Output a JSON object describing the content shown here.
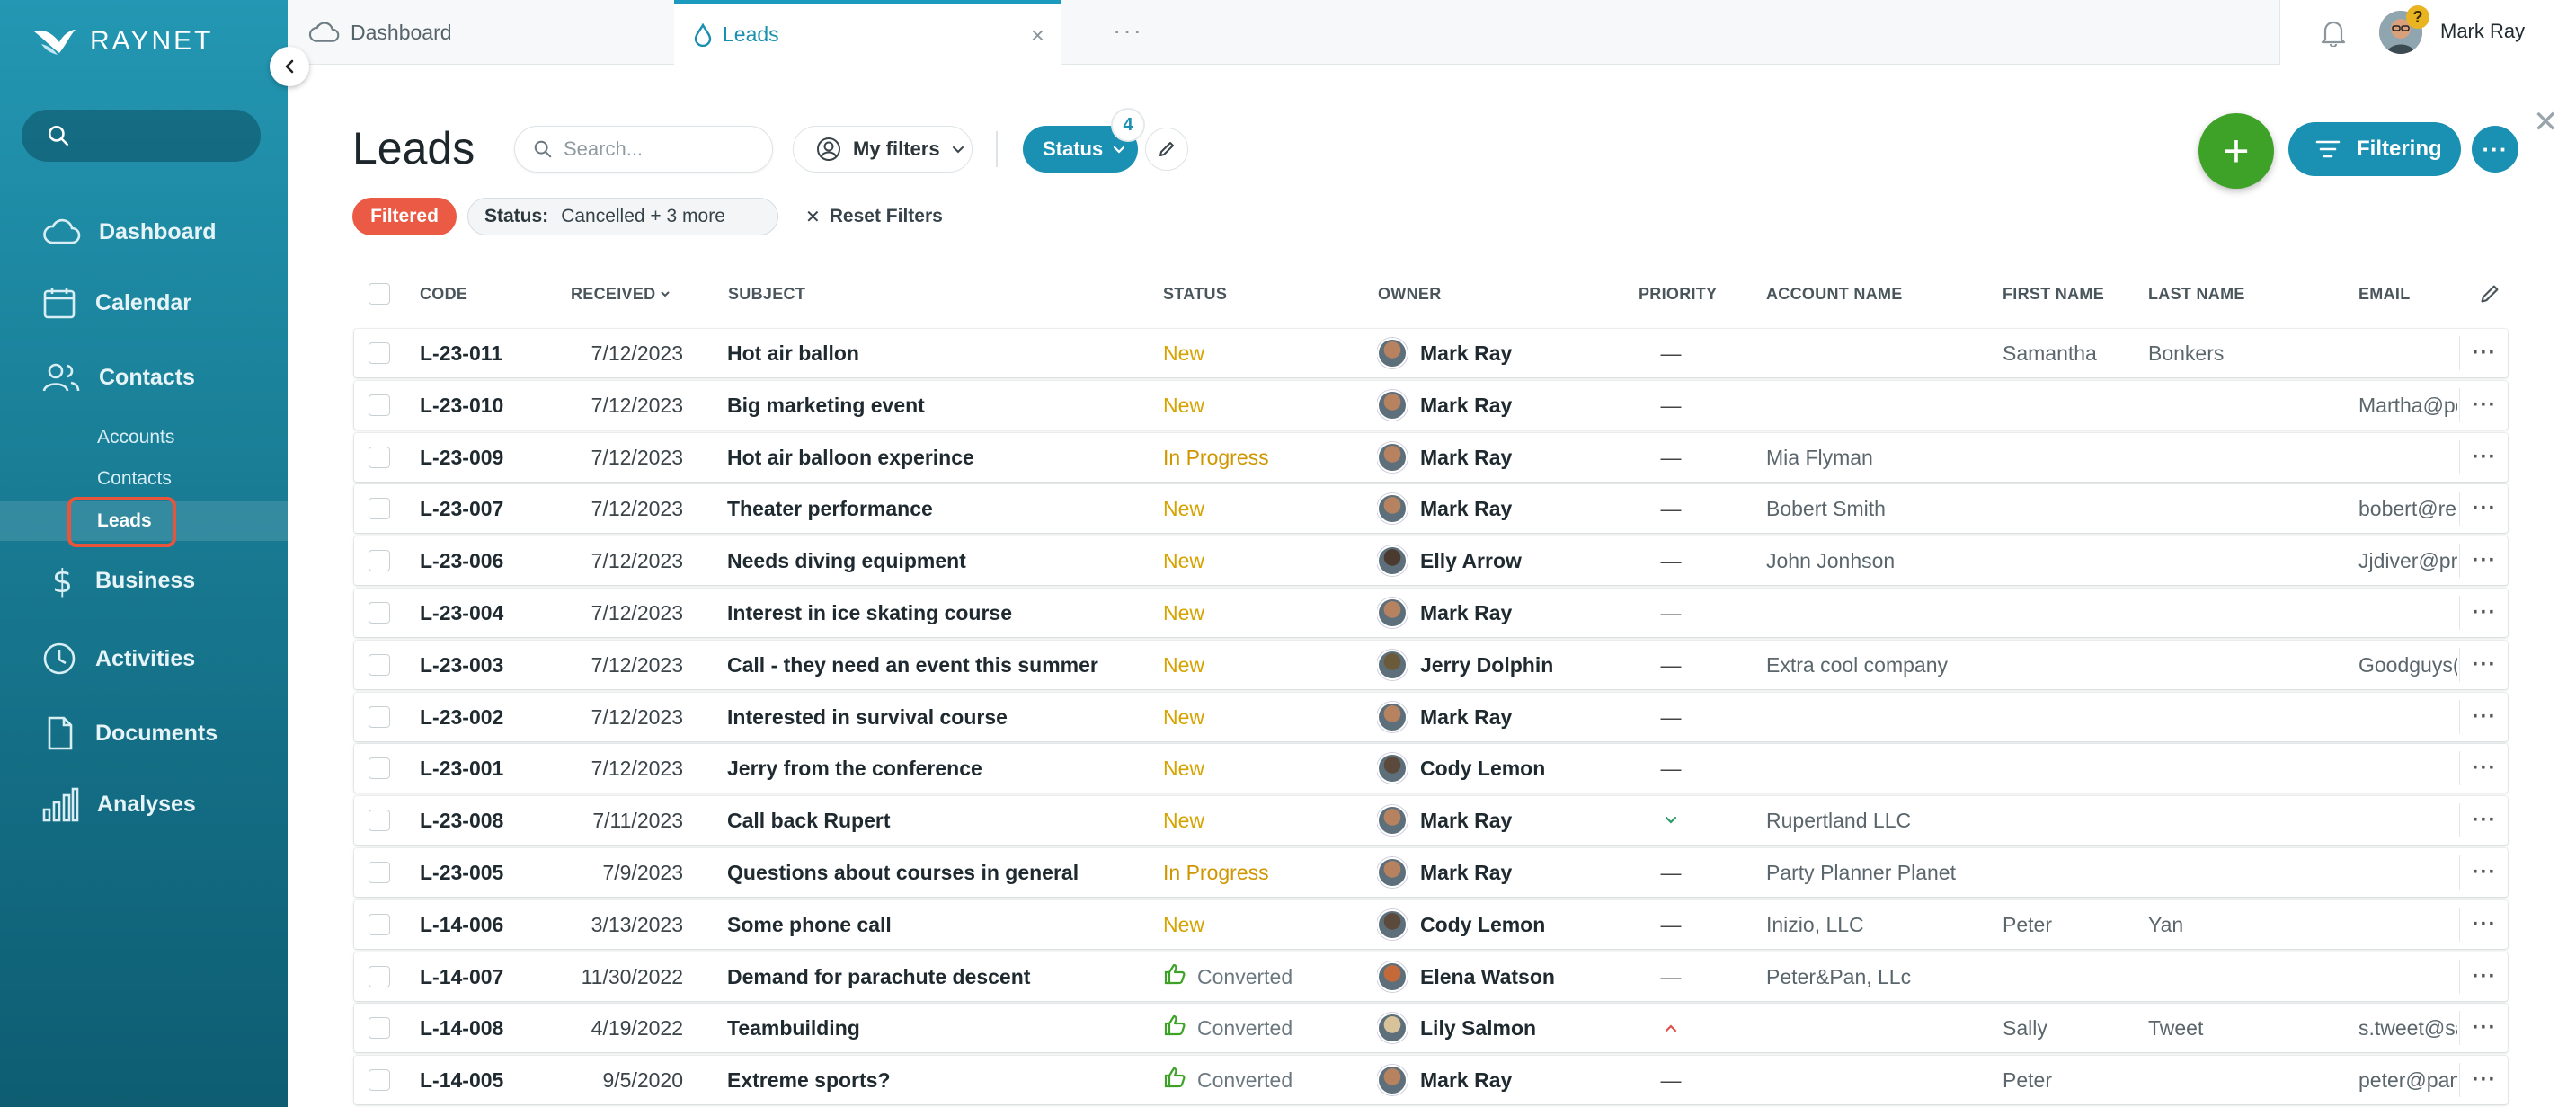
{
  "app": {
    "brand": "RAYNET"
  },
  "sidebar": {
    "search_placeholder": "",
    "nav": [
      {
        "label": "Dashboard",
        "icon": "cloud-icon"
      },
      {
        "label": "Calendar",
        "icon": "calendar-icon"
      },
      {
        "label": "Contacts",
        "icon": "contacts-icon"
      },
      {
        "label": "Business",
        "icon": "dollar-icon"
      },
      {
        "label": "Activities",
        "icon": "clock-icon"
      },
      {
        "label": "Documents",
        "icon": "document-icon"
      },
      {
        "label": "Analyses",
        "icon": "bar-chart-icon"
      }
    ],
    "sub_items": [
      {
        "label": "Accounts"
      },
      {
        "label": "Contacts"
      },
      {
        "label": "Leads",
        "active": true
      }
    ]
  },
  "tabs": [
    {
      "label": "Dashboard",
      "icon": "cloud-icon"
    },
    {
      "label": "Leads",
      "icon": "lead-drop-icon",
      "active": true
    }
  ],
  "user": {
    "name": "Mark Ray",
    "help_badge": "?"
  },
  "header": {
    "title": "Leads",
    "search_placeholder": "Search...",
    "my_filters": "My filters",
    "status_label": "Status",
    "status_count": "4",
    "add_symbol": "+",
    "filtering_label": "Filtering"
  },
  "filters": {
    "filtered_label": "Filtered",
    "status_key": "Status:",
    "status_value": "Cancelled + 3 more",
    "reset_label": "Reset Filters"
  },
  "table": {
    "columns": [
      "CODE",
      "RECEIVED",
      "SUBJECT",
      "STATUS",
      "OWNER",
      "PRIORITY",
      "ACCOUNT NAME",
      "FIRST NAME",
      "LAST NAME",
      "EMAIL"
    ],
    "rows": [
      {
        "code": "L-23-011",
        "received": "7/12/2023",
        "subject": "Hot air ballon",
        "status": "New",
        "owner": "Mark Ray",
        "priority": "—",
        "account": "",
        "first": "Samantha",
        "last": "Bonkers",
        "email": ""
      },
      {
        "code": "L-23-010",
        "received": "7/12/2023",
        "subject": "Big marketing event",
        "status": "New",
        "owner": "Mark Ray",
        "priority": "—",
        "account": "",
        "first": "",
        "last": "",
        "email": "Martha@pe"
      },
      {
        "code": "L-23-009",
        "received": "7/12/2023",
        "subject": "Hot air balloon experince",
        "status": "In Progress",
        "owner": "Mark Ray",
        "priority": "—",
        "account": "Mia Flyman",
        "first": "",
        "last": "",
        "email": ""
      },
      {
        "code": "L-23-007",
        "received": "7/12/2023",
        "subject": "Theater performance",
        "status": "New",
        "owner": "Mark Ray",
        "priority": "—",
        "account": "Bobert Smith",
        "first": "",
        "last": "",
        "email": "bobert@re"
      },
      {
        "code": "L-23-006",
        "received": "7/12/2023",
        "subject": "Needs diving equipment",
        "status": "New",
        "owner": "Elly Arrow",
        "priority": "—",
        "account": "John Jonhson",
        "first": "",
        "last": "",
        "email": "Jjdiver@pr"
      },
      {
        "code": "L-23-004",
        "received": "7/12/2023",
        "subject": "Interest in ice skating course",
        "status": "New",
        "owner": "Mark Ray",
        "priority": "—",
        "account": "",
        "first": "",
        "last": "",
        "email": ""
      },
      {
        "code": "L-23-003",
        "received": "7/12/2023",
        "subject": "Call - they need an event this summer",
        "status": "New",
        "owner": "Jerry Dolphin",
        "priority": "—",
        "account": "Extra cool company",
        "first": "",
        "last": "",
        "email": "Goodguys("
      },
      {
        "code": "L-23-002",
        "received": "7/12/2023",
        "subject": "Interested in survival course",
        "status": "New",
        "owner": "Mark Ray",
        "priority": "—",
        "account": "",
        "first": "",
        "last": "",
        "email": ""
      },
      {
        "code": "L-23-001",
        "received": "7/12/2023",
        "subject": "Jerry from the conference",
        "status": "New",
        "owner": "Cody Lemon",
        "priority": "—",
        "account": "",
        "first": "",
        "last": "",
        "email": ""
      },
      {
        "code": "L-23-008",
        "received": "7/11/2023",
        "subject": "Call back Rupert",
        "status": "New",
        "owner": "Mark Ray",
        "priority": "low",
        "account": "Rupertland LLC",
        "first": "",
        "last": "",
        "email": ""
      },
      {
        "code": "L-23-005",
        "received": "7/9/2023",
        "subject": "Questions about courses in general",
        "status": "In Progress",
        "owner": "Mark Ray",
        "priority": "—",
        "account": "Party Planner Planet",
        "first": "",
        "last": "",
        "email": ""
      },
      {
        "code": "L-14-006",
        "received": "3/13/2023",
        "subject": "Some phone call",
        "status": "New",
        "owner": "Cody Lemon",
        "priority": "—",
        "account": "Inizio, LLC",
        "first": "Peter",
        "last": "Yan",
        "email": ""
      },
      {
        "code": "L-14-007",
        "received": "11/30/2022",
        "subject": "Demand for parachute descent",
        "status": "Converted",
        "owner": "Elena Watson",
        "priority": "—",
        "account": "Peter&Pan, LLc",
        "first": "",
        "last": "",
        "email": ""
      },
      {
        "code": "L-14-008",
        "received": "4/19/2022",
        "subject": "Teambuilding",
        "status": "Converted",
        "owner": "Lily Salmon",
        "priority": "high",
        "account": "",
        "first": "Sally",
        "last": "Tweet",
        "email": "s.tweet@sa"
      },
      {
        "code": "L-14-005",
        "received": "9/5/2020",
        "subject": "Extreme sports?",
        "status": "Converted",
        "owner": "Mark Ray",
        "priority": "—",
        "account": "",
        "first": "Peter",
        "last": "",
        "email": "peter@pan"
      }
    ]
  },
  "colors": {
    "sidebar_top": "#2397b3",
    "sidebar_bottom": "#0e5d72",
    "accent": "#1a90b2",
    "add_green": "#3ea229",
    "filtered_red": "#ea5a44",
    "status_new": "#d6a400",
    "status_converted": "#6b787f",
    "converted_icon": "#3ea229"
  }
}
